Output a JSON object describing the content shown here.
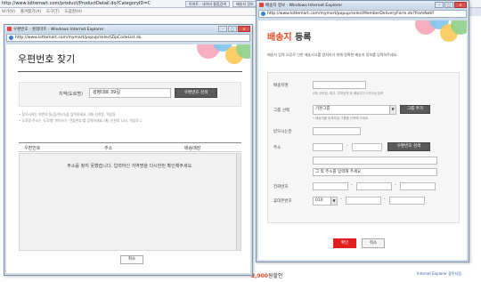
{
  "bg_browser": {
    "url": "http://www.lottemart.com/product/ProductDetail.do?CategoryID=C",
    "tab1": "아마트 : 네이버 통합검색",
    "tab2": "배송지 정보",
    "menu": [
      "보기(V)",
      "즐겨찾기(A)",
      "도구(T)",
      "도움말(H)"
    ],
    "footer_price": "2,900",
    "footer_suffix": "원할인",
    "right_link": "Internet Explorer 광주지점"
  },
  "zip_popup": {
    "window_title": "우편번호 : 롯데마트 - Windows Internet Explorer",
    "url": "http://www.lottemart.com/mymart/popup/selectZipCodeList.do",
    "heading": "우편번호 찾기",
    "search_label": "지역(도로명)",
    "search_value": "광평대로 39길",
    "search_button": "우편번호 검색",
    "notes": [
      "• 찾으시려는 지번의 동(읍/면/리)을 입력하세요. (예) 신천동, 역삼동",
      "• 도로명 주소는 '도로명' 띄어쓰기 '건물번호'를 입력하세요.(예) 신천로 135, 역삼로 1"
    ],
    "columns": [
      "우편번호",
      "주소",
      "배송매장"
    ],
    "empty_message": "주소를 찾지 못했습니다. 입력하신 지역명을 다시한번 확인해주세요.",
    "cancel_button": "취소"
  },
  "addr_popup": {
    "window_title": "배송지 정보 - Windows Internet Explorer",
    "url": "http://www.lottemart.com/mymart/popup/selectMemberDeliveryForm.do?fromNotif",
    "title_red": "배송지",
    "title_black": " 등록",
    "description": "배송지 입력 오류로 인한 배송사고를 방지하기 위해 정확한 배송지 정보를 입력하주세요.",
    "labels": {
      "name": "배송지명",
      "group": "그룹 선택",
      "recipient": "받으시는분",
      "address": "주소",
      "phone": "전화번호",
      "mobile": "휴대폰번호"
    },
    "name_hint": "(예) 우리집, 회사, 부모님댁 등 배송지가 2자이상 입력",
    "group_value": "기본그룹",
    "group_button": "그룹 추가",
    "group_hint": "• 배송지를 등록하실 그룹을 선택해 주세요.",
    "zip_button": "우편번호 검색",
    "detail_placeholder": "그 외 주소를 입력해 주세요",
    "mobile_prefix": "010",
    "confirm_button": "확인",
    "cancel_button": "취소"
  },
  "colors": {
    "accent_red": "#e8481d",
    "confirm_red": "#e02020",
    "dark_button": "#5b5b5b"
  }
}
